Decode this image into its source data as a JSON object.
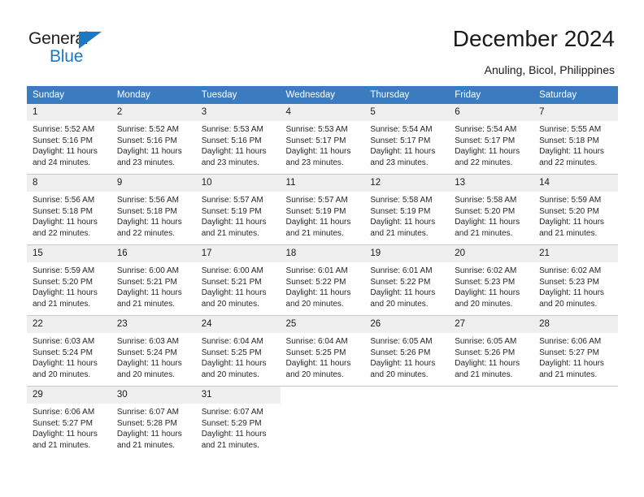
{
  "brand": {
    "name_top": "General",
    "name_bottom": "Blue",
    "triangle_color": "#1b79c3",
    "text_color": "#231f20"
  },
  "header": {
    "title": "December 2024",
    "subtitle": "Anuling, Bicol, Philippines"
  },
  "theme": {
    "header_bg": "#3b7cc0",
    "header_text": "#ffffff",
    "daynum_bg": "#efefef",
    "cell_bg": "#ffffff",
    "grid_line": "#c8c8c8"
  },
  "weekdays": [
    "Sunday",
    "Monday",
    "Tuesday",
    "Wednesday",
    "Thursday",
    "Friday",
    "Saturday"
  ],
  "weeks": [
    [
      {
        "day": "1",
        "sunrise": "Sunrise: 5:52 AM",
        "sunset": "Sunset: 5:16 PM",
        "daylight1": "Daylight: 11 hours",
        "daylight2": "and 24 minutes."
      },
      {
        "day": "2",
        "sunrise": "Sunrise: 5:52 AM",
        "sunset": "Sunset: 5:16 PM",
        "daylight1": "Daylight: 11 hours",
        "daylight2": "and 23 minutes."
      },
      {
        "day": "3",
        "sunrise": "Sunrise: 5:53 AM",
        "sunset": "Sunset: 5:16 PM",
        "daylight1": "Daylight: 11 hours",
        "daylight2": "and 23 minutes."
      },
      {
        "day": "4",
        "sunrise": "Sunrise: 5:53 AM",
        "sunset": "Sunset: 5:17 PM",
        "daylight1": "Daylight: 11 hours",
        "daylight2": "and 23 minutes."
      },
      {
        "day": "5",
        "sunrise": "Sunrise: 5:54 AM",
        "sunset": "Sunset: 5:17 PM",
        "daylight1": "Daylight: 11 hours",
        "daylight2": "and 23 minutes."
      },
      {
        "day": "6",
        "sunrise": "Sunrise: 5:54 AM",
        "sunset": "Sunset: 5:17 PM",
        "daylight1": "Daylight: 11 hours",
        "daylight2": "and 22 minutes."
      },
      {
        "day": "7",
        "sunrise": "Sunrise: 5:55 AM",
        "sunset": "Sunset: 5:18 PM",
        "daylight1": "Daylight: 11 hours",
        "daylight2": "and 22 minutes."
      }
    ],
    [
      {
        "day": "8",
        "sunrise": "Sunrise: 5:56 AM",
        "sunset": "Sunset: 5:18 PM",
        "daylight1": "Daylight: 11 hours",
        "daylight2": "and 22 minutes."
      },
      {
        "day": "9",
        "sunrise": "Sunrise: 5:56 AM",
        "sunset": "Sunset: 5:18 PM",
        "daylight1": "Daylight: 11 hours",
        "daylight2": "and 22 minutes."
      },
      {
        "day": "10",
        "sunrise": "Sunrise: 5:57 AM",
        "sunset": "Sunset: 5:19 PM",
        "daylight1": "Daylight: 11 hours",
        "daylight2": "and 21 minutes."
      },
      {
        "day": "11",
        "sunrise": "Sunrise: 5:57 AM",
        "sunset": "Sunset: 5:19 PM",
        "daylight1": "Daylight: 11 hours",
        "daylight2": "and 21 minutes."
      },
      {
        "day": "12",
        "sunrise": "Sunrise: 5:58 AM",
        "sunset": "Sunset: 5:19 PM",
        "daylight1": "Daylight: 11 hours",
        "daylight2": "and 21 minutes."
      },
      {
        "day": "13",
        "sunrise": "Sunrise: 5:58 AM",
        "sunset": "Sunset: 5:20 PM",
        "daylight1": "Daylight: 11 hours",
        "daylight2": "and 21 minutes."
      },
      {
        "day": "14",
        "sunrise": "Sunrise: 5:59 AM",
        "sunset": "Sunset: 5:20 PM",
        "daylight1": "Daylight: 11 hours",
        "daylight2": "and 21 minutes."
      }
    ],
    [
      {
        "day": "15",
        "sunrise": "Sunrise: 5:59 AM",
        "sunset": "Sunset: 5:20 PM",
        "daylight1": "Daylight: 11 hours",
        "daylight2": "and 21 minutes."
      },
      {
        "day": "16",
        "sunrise": "Sunrise: 6:00 AM",
        "sunset": "Sunset: 5:21 PM",
        "daylight1": "Daylight: 11 hours",
        "daylight2": "and 21 minutes."
      },
      {
        "day": "17",
        "sunrise": "Sunrise: 6:00 AM",
        "sunset": "Sunset: 5:21 PM",
        "daylight1": "Daylight: 11 hours",
        "daylight2": "and 20 minutes."
      },
      {
        "day": "18",
        "sunrise": "Sunrise: 6:01 AM",
        "sunset": "Sunset: 5:22 PM",
        "daylight1": "Daylight: 11 hours",
        "daylight2": "and 20 minutes."
      },
      {
        "day": "19",
        "sunrise": "Sunrise: 6:01 AM",
        "sunset": "Sunset: 5:22 PM",
        "daylight1": "Daylight: 11 hours",
        "daylight2": "and 20 minutes."
      },
      {
        "day": "20",
        "sunrise": "Sunrise: 6:02 AM",
        "sunset": "Sunset: 5:23 PM",
        "daylight1": "Daylight: 11 hours",
        "daylight2": "and 20 minutes."
      },
      {
        "day": "21",
        "sunrise": "Sunrise: 6:02 AM",
        "sunset": "Sunset: 5:23 PM",
        "daylight1": "Daylight: 11 hours",
        "daylight2": "and 20 minutes."
      }
    ],
    [
      {
        "day": "22",
        "sunrise": "Sunrise: 6:03 AM",
        "sunset": "Sunset: 5:24 PM",
        "daylight1": "Daylight: 11 hours",
        "daylight2": "and 20 minutes."
      },
      {
        "day": "23",
        "sunrise": "Sunrise: 6:03 AM",
        "sunset": "Sunset: 5:24 PM",
        "daylight1": "Daylight: 11 hours",
        "daylight2": "and 20 minutes."
      },
      {
        "day": "24",
        "sunrise": "Sunrise: 6:04 AM",
        "sunset": "Sunset: 5:25 PM",
        "daylight1": "Daylight: 11 hours",
        "daylight2": "and 20 minutes."
      },
      {
        "day": "25",
        "sunrise": "Sunrise: 6:04 AM",
        "sunset": "Sunset: 5:25 PM",
        "daylight1": "Daylight: 11 hours",
        "daylight2": "and 20 minutes."
      },
      {
        "day": "26",
        "sunrise": "Sunrise: 6:05 AM",
        "sunset": "Sunset: 5:26 PM",
        "daylight1": "Daylight: 11 hours",
        "daylight2": "and 20 minutes."
      },
      {
        "day": "27",
        "sunrise": "Sunrise: 6:05 AM",
        "sunset": "Sunset: 5:26 PM",
        "daylight1": "Daylight: 11 hours",
        "daylight2": "and 21 minutes."
      },
      {
        "day": "28",
        "sunrise": "Sunrise: 6:06 AM",
        "sunset": "Sunset: 5:27 PM",
        "daylight1": "Daylight: 11 hours",
        "daylight2": "and 21 minutes."
      }
    ],
    [
      {
        "day": "29",
        "sunrise": "Sunrise: 6:06 AM",
        "sunset": "Sunset: 5:27 PM",
        "daylight1": "Daylight: 11 hours",
        "daylight2": "and 21 minutes."
      },
      {
        "day": "30",
        "sunrise": "Sunrise: 6:07 AM",
        "sunset": "Sunset: 5:28 PM",
        "daylight1": "Daylight: 11 hours",
        "daylight2": "and 21 minutes."
      },
      {
        "day": "31",
        "sunrise": "Sunrise: 6:07 AM",
        "sunset": "Sunset: 5:29 PM",
        "daylight1": "Daylight: 11 hours",
        "daylight2": "and 21 minutes."
      },
      {
        "day": "",
        "sunrise": "",
        "sunset": "",
        "daylight1": "",
        "daylight2": ""
      },
      {
        "day": "",
        "sunrise": "",
        "sunset": "",
        "daylight1": "",
        "daylight2": ""
      },
      {
        "day": "",
        "sunrise": "",
        "sunset": "",
        "daylight1": "",
        "daylight2": ""
      },
      {
        "day": "",
        "sunrise": "",
        "sunset": "",
        "daylight1": "",
        "daylight2": ""
      }
    ]
  ]
}
